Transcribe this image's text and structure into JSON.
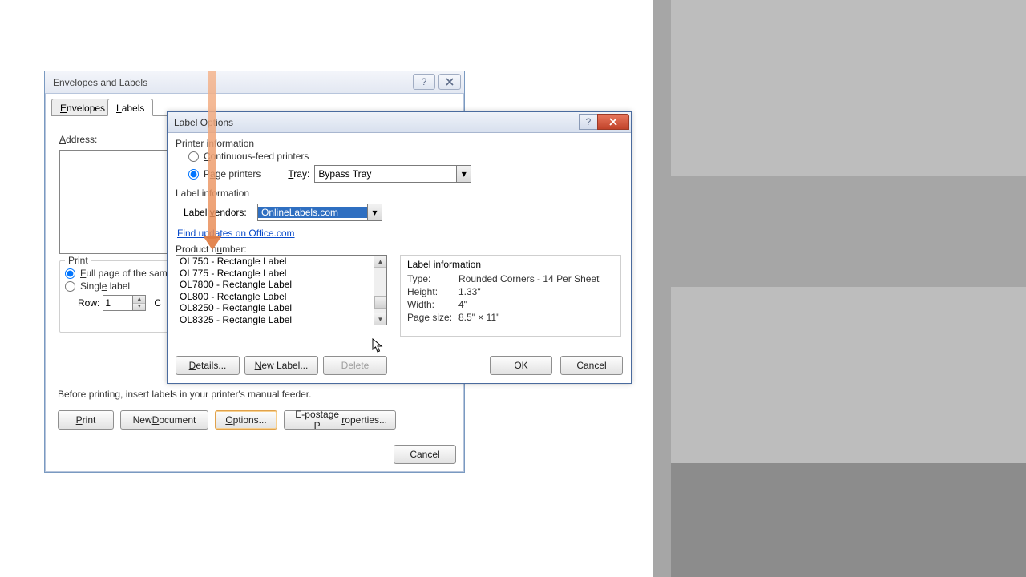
{
  "dialog1": {
    "title": "Envelopes and Labels",
    "tabs": {
      "envelopes": "Envelopes",
      "labels": "Labels"
    },
    "address_label": "Address:",
    "print": {
      "legend": "Print",
      "opt_full": "Full page of the sam",
      "opt_single": "Single label",
      "row_label": "Row:",
      "row_value": "1",
      "col_label_trunc": "C"
    },
    "footer": "Before printing, insert labels in your printer's manual feeder.",
    "buttons": {
      "print": "Print",
      "new_doc": "New Document",
      "options": "Options...",
      "epostage": "E-postage Properties...",
      "cancel": "Cancel"
    }
  },
  "dialog2": {
    "title": "Label Options",
    "printer_info": "Printer information",
    "radio_cont": "Continuous-feed printers",
    "radio_page": "Page printers",
    "tray_label": "Tray:",
    "tray_value": "Bypass Tray",
    "label_info_section": "Label information",
    "vendors_label": "Label vendors:",
    "vendors_value": "OnlineLabels.com",
    "updates_link": "Find updates on Office.com",
    "product_label": "Product number:",
    "products": [
      "OL750 - Rectangle Label",
      "OL775 - Rectangle Label",
      "OL7800 - Rectangle Label",
      "OL800 - Rectangle Label",
      "OL8250 - Rectangle Label",
      "OL8325 - Rectangle Label"
    ],
    "info_panel": {
      "title": "Label information",
      "type_k": "Type:",
      "type_v": "Rounded Corners - 14 Per Sheet",
      "height_k": "Height:",
      "height_v": "1.33\"",
      "width_k": "Width:",
      "width_v": "4\"",
      "page_k": "Page size:",
      "page_v": "8.5\" × 11\""
    },
    "buttons": {
      "details": "Details...",
      "new_label": "New Label...",
      "delete": "Delete",
      "ok": "OK",
      "cancel": "Cancel"
    }
  }
}
